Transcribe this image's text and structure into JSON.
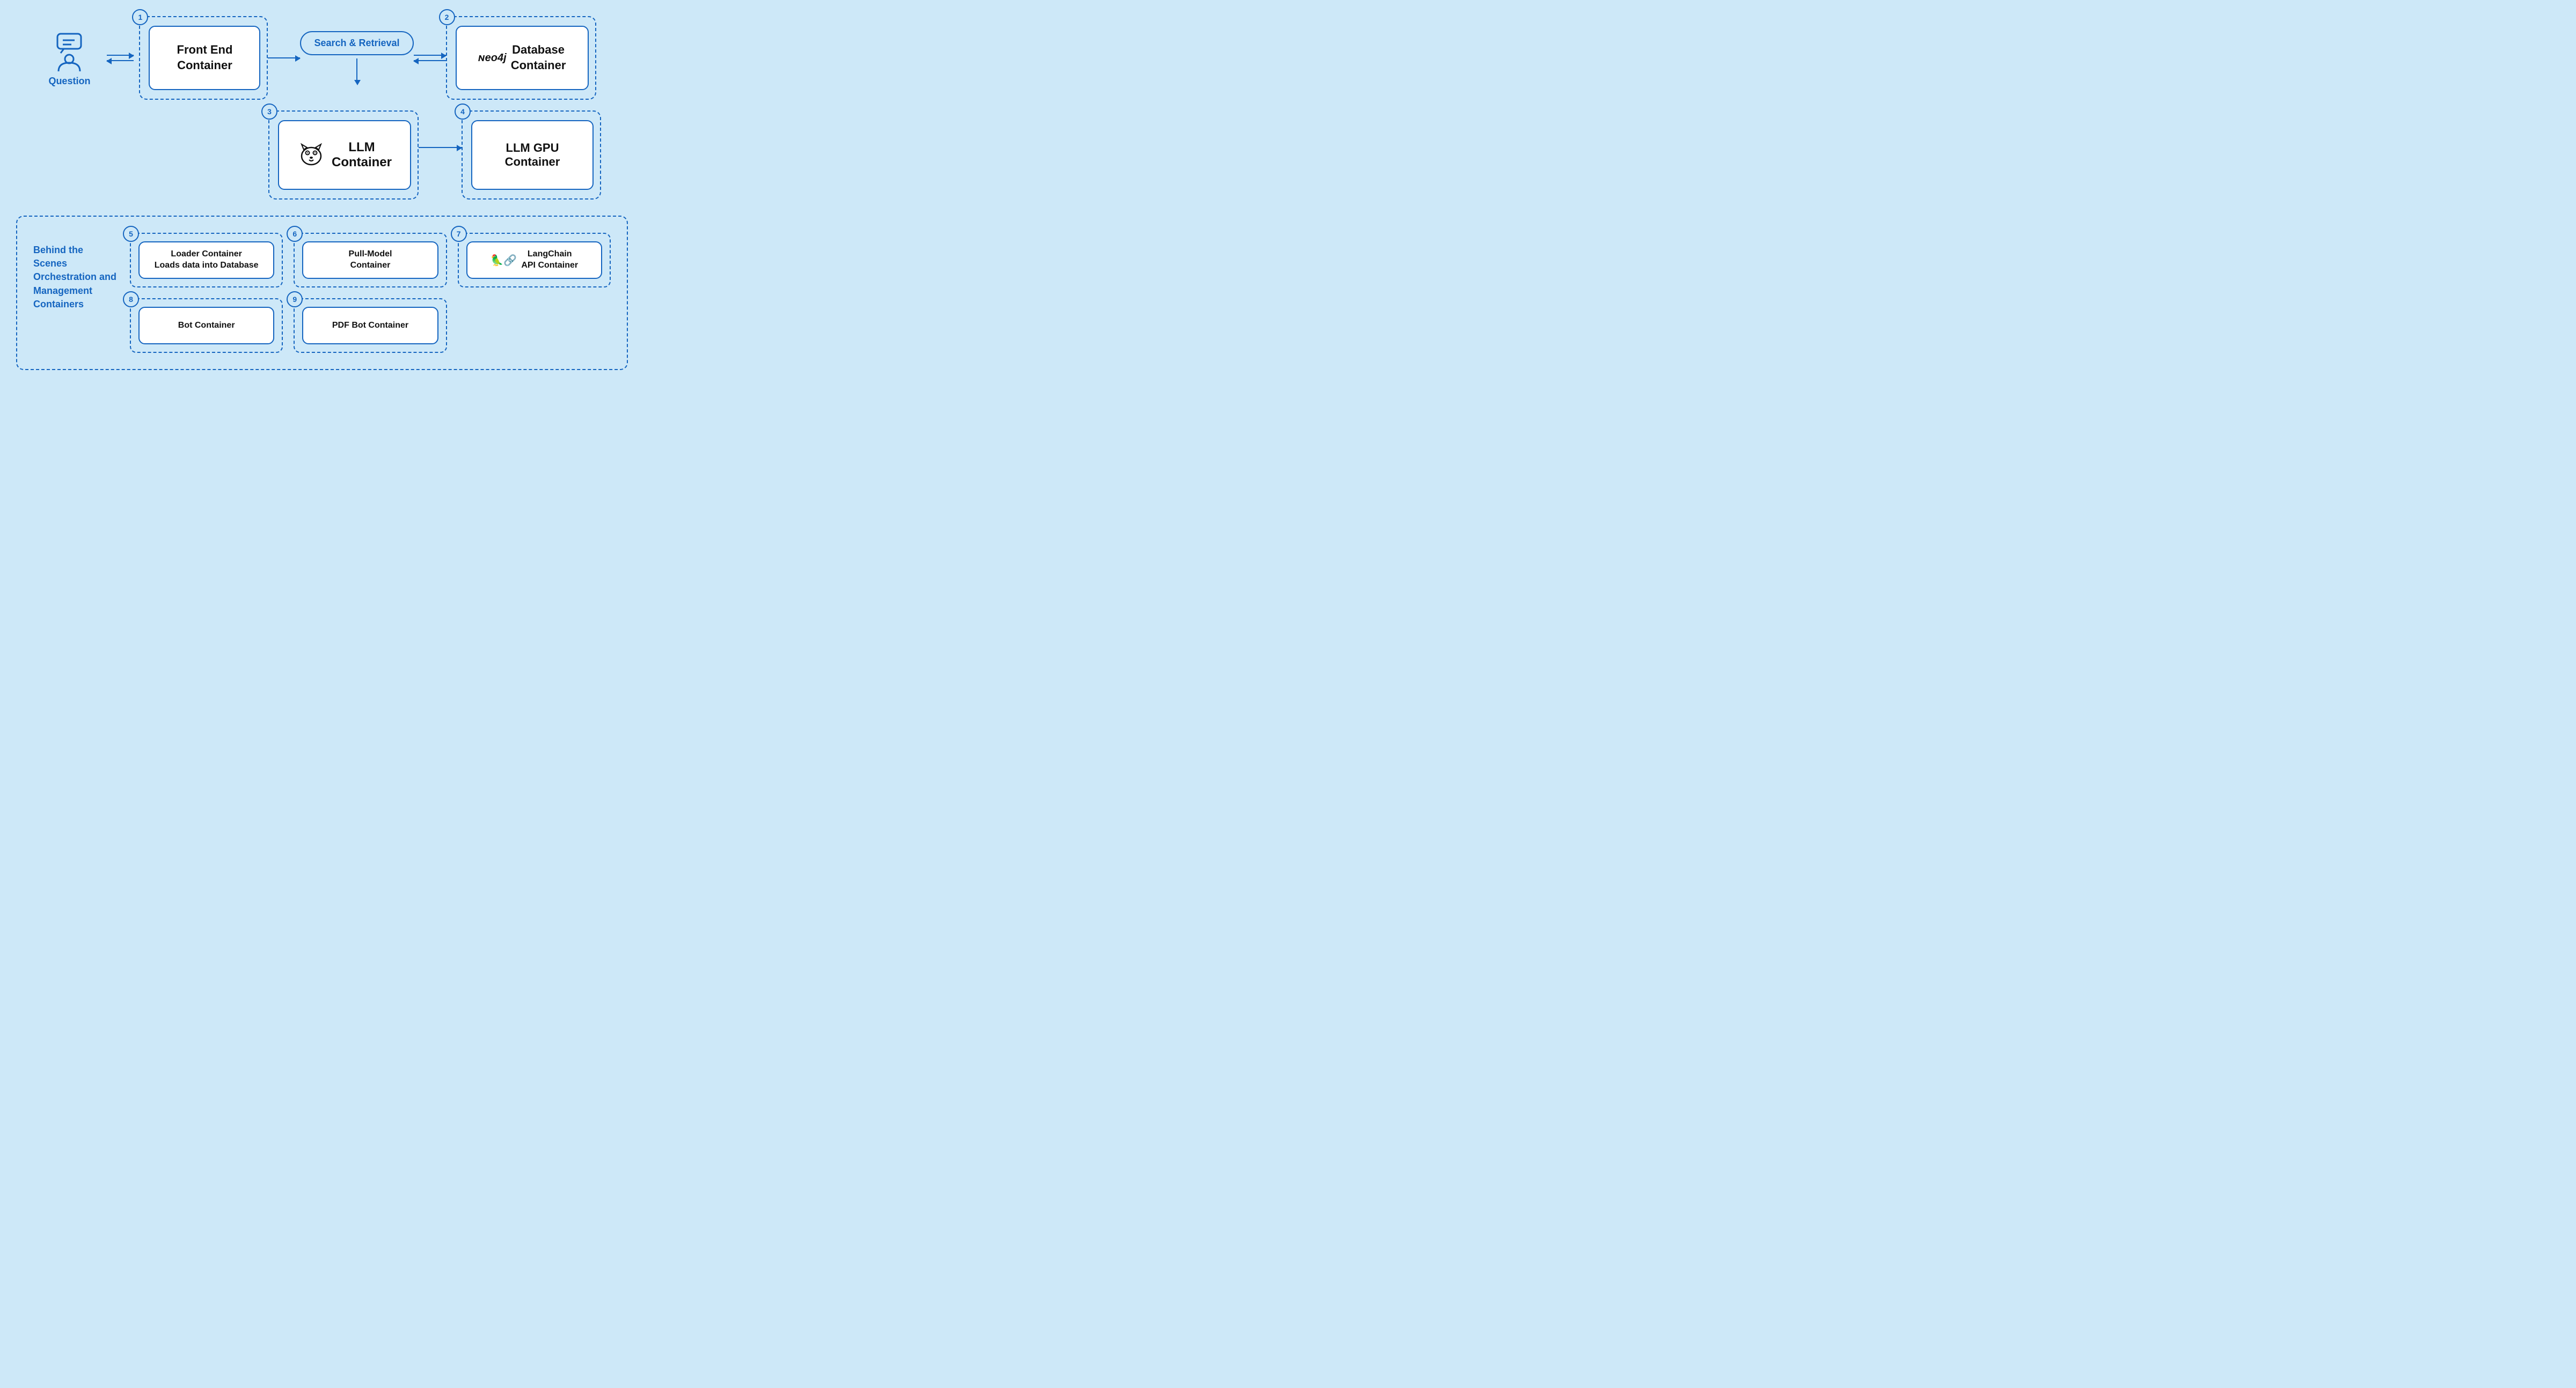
{
  "diagram": {
    "background": "#cde8f8",
    "question": {
      "label": "Question"
    },
    "containers": {
      "frontend": {
        "badge": "1",
        "label": "Front End\nContainer"
      },
      "search": {
        "label": "Search & Retrieval"
      },
      "database": {
        "badge": "2",
        "neo4j_logo": "neo4j",
        "label": "Database\nContainer"
      },
      "llm": {
        "badge": "3",
        "label": "LLM\nContainer"
      },
      "llm_gpu": {
        "badge": "4",
        "label": "LLM GPU\nContainer"
      }
    },
    "behind_scenes": {
      "label": "Behind the Scenes\nOrchestration and\nManagement\nContainers",
      "items": [
        {
          "badge": "5",
          "label": "Loader Container\nLoads data into Database"
        },
        {
          "badge": "6",
          "label": "Pull-Model\nContainer"
        },
        {
          "badge": "7",
          "icon": "🦜🔗",
          "label": "LangChain\nAPI Container"
        },
        {
          "badge": "8",
          "label": "Bot Container"
        },
        {
          "badge": "9",
          "label": "PDF Bot Container"
        }
      ]
    }
  }
}
